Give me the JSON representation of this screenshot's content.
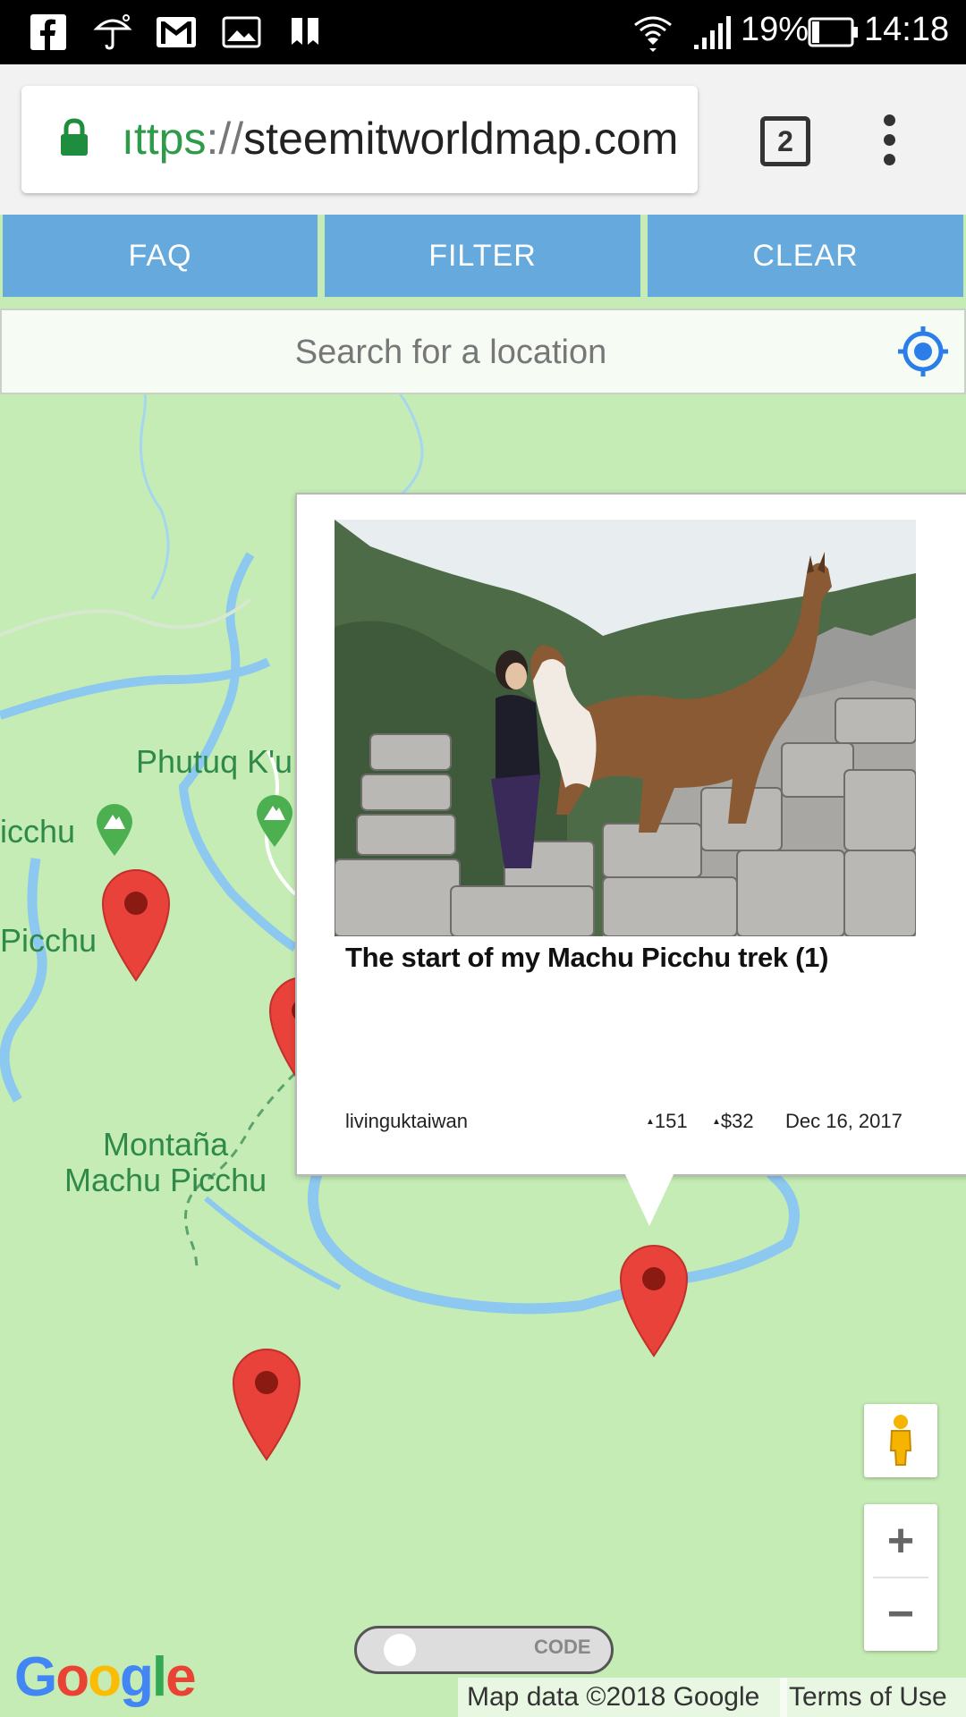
{
  "status_bar": {
    "battery": "19%",
    "time": "14:18",
    "left_icons": [
      "facebook-icon",
      "umbrella-icon",
      "gmail-icon",
      "image-icon",
      "bookmark-icon"
    ],
    "right_icons": [
      "wifi-icon",
      "signal-icon",
      "battery-icon"
    ]
  },
  "browser": {
    "url_scheme": "ıttps",
    "url_sep": "://",
    "url_host": "steemitworldmap.com",
    "tab_count": "2"
  },
  "toolbar": {
    "faq_label": "FAQ",
    "filter_label": "FILTER",
    "clear_label": "CLEAR"
  },
  "search": {
    "placeholder": "Search for a location"
  },
  "map_labels": {
    "phutuq": "Phutuq K'u",
    "icchu": "icchu",
    "picchu": "Picchu",
    "montana_line1": "Montaña",
    "montana_line2": "Machu Picchu"
  },
  "popup": {
    "title": "The start of my Machu Picchu trek (1)",
    "author": "livinguktaiwan",
    "votes": "151",
    "payout": "$32",
    "date": "Dec 16, 2017",
    "vote_icon": "up-triangle-icon"
  },
  "controls": {
    "zoom_in": "+",
    "zoom_out": "−",
    "code_label": "CODE"
  },
  "attribution": {
    "map_data": "Map data ©2018 Google",
    "terms": "Terms of Use",
    "logo": "Google"
  },
  "colors": {
    "nav_button": "#65a9dd",
    "map_bg": "#c5ecb4",
    "pin_red": "#e8423a",
    "water": "#8cc8ef"
  }
}
